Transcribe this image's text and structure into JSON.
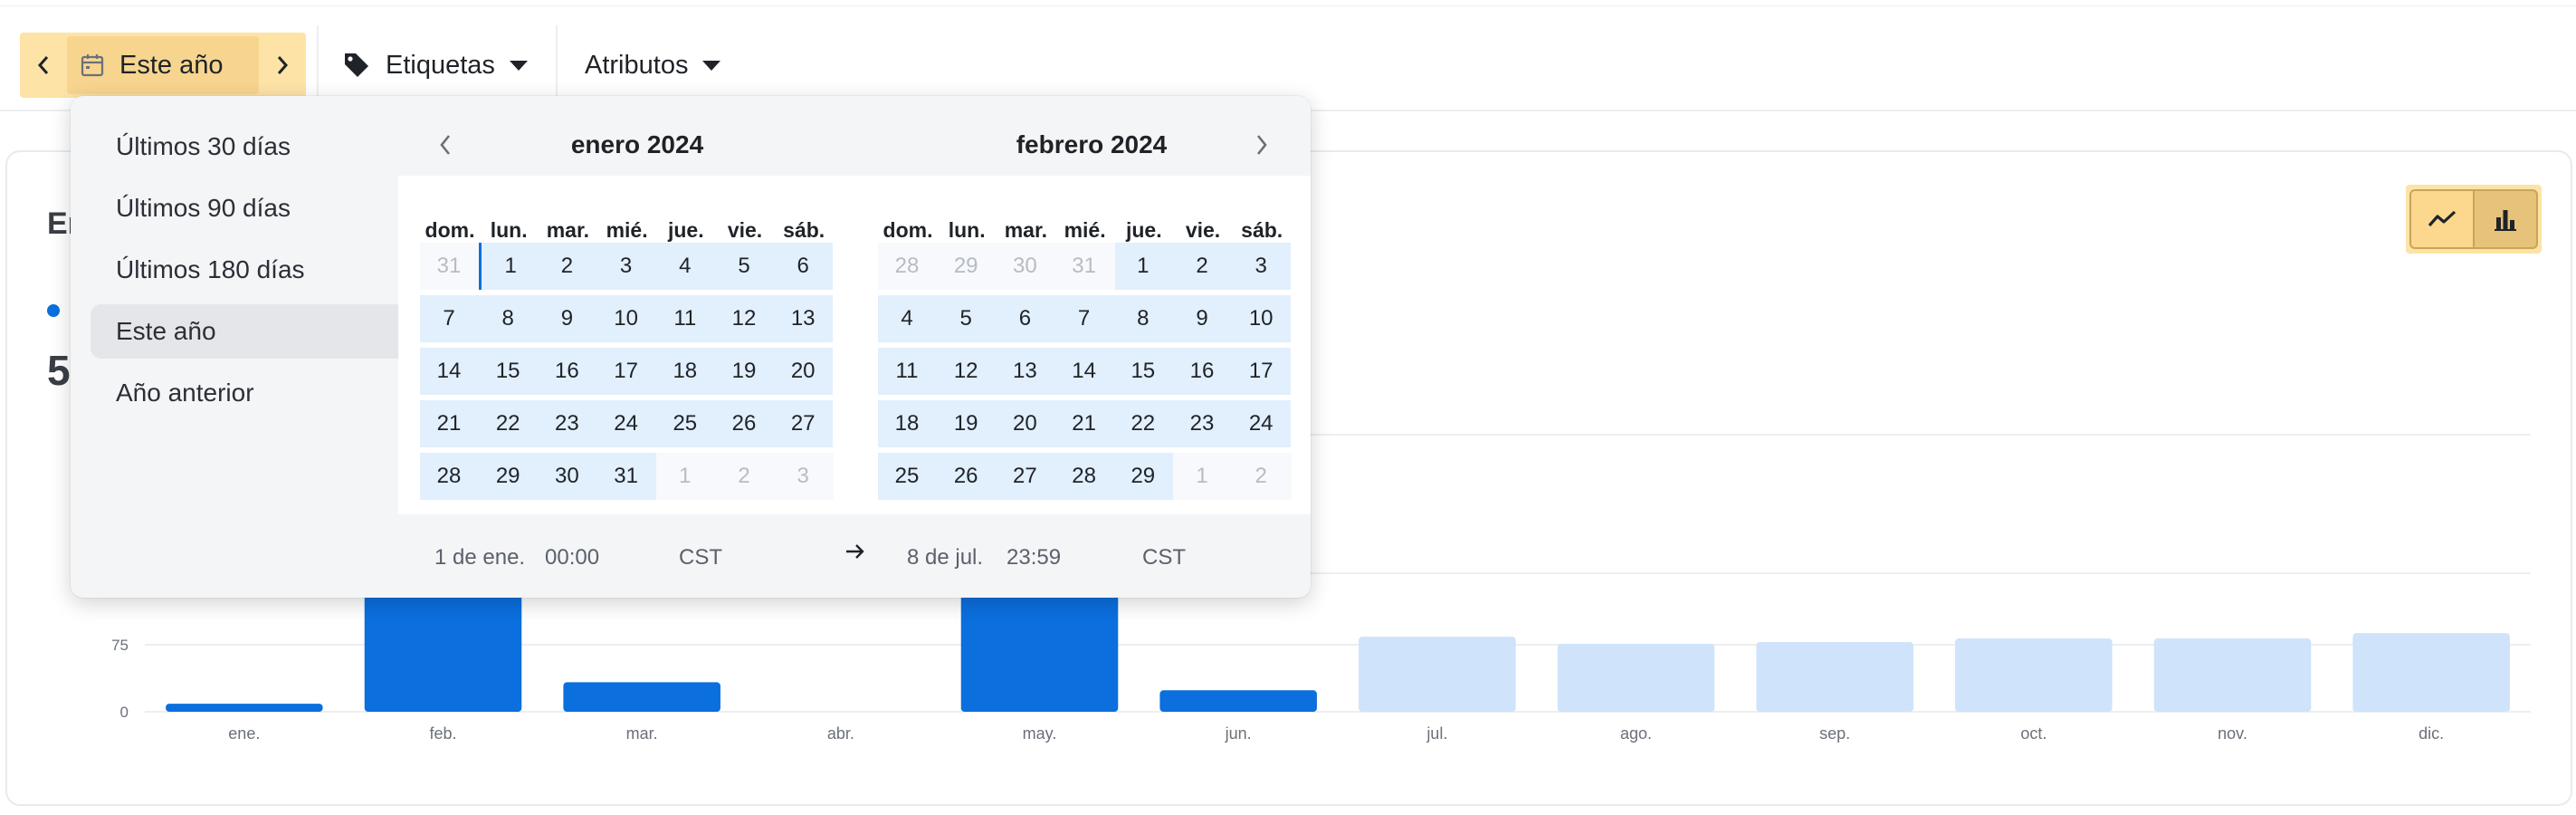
{
  "toolbar": {
    "date_range_label": "Este año",
    "tags_label": "Etiquetas",
    "attributes_label": "Atributos"
  },
  "card": {
    "title_partial": "En",
    "metric_partial": "5"
  },
  "chart_data": {
    "type": "bar",
    "categories": [
      "ene.",
      "feb.",
      "mar.",
      "abr.",
      "may.",
      "jun.",
      "jul.",
      "ago.",
      "sep.",
      "oct.",
      "nov.",
      "dic."
    ],
    "values": [
      9,
      140,
      33,
      0,
      140,
      24,
      84,
      76,
      78,
      82,
      82,
      88
    ],
    "projected_from_index": 6,
    "yticks": [
      0,
      75
    ],
    "ylim": [
      0,
      310
    ],
    "colors": {
      "actual": "#0b6fde",
      "projected": "#cfe3fb"
    }
  },
  "popover": {
    "presets": [
      {
        "label": "Últimos 30 días",
        "active": false
      },
      {
        "label": "Últimos 90 días",
        "active": false
      },
      {
        "label": "Últimos 180 días",
        "active": false
      },
      {
        "label": "Este año",
        "active": true
      },
      {
        "label": "Año anterior",
        "active": false
      }
    ],
    "calendars": [
      {
        "title": "enero 2024",
        "weekdays": [
          "dom.",
          "lun.",
          "mar.",
          "mié.",
          "jue.",
          "vie.",
          "sáb."
        ],
        "weeks": [
          [
            "31",
            "1",
            "2",
            "3",
            "4",
            "5",
            "6"
          ],
          [
            "7",
            "8",
            "9",
            "10",
            "11",
            "12",
            "13"
          ],
          [
            "14",
            "15",
            "16",
            "17",
            "18",
            "19",
            "20"
          ],
          [
            "21",
            "22",
            "23",
            "24",
            "25",
            "26",
            "27"
          ],
          [
            "28",
            "29",
            "30",
            "31",
            "1",
            "2",
            "3"
          ]
        ],
        "outside": [
          [
            0,
            0
          ],
          [
            4,
            4
          ],
          [
            4,
            5
          ],
          [
            4,
            6
          ]
        ]
      },
      {
        "title": "febrero 2024",
        "weekdays": [
          "dom.",
          "lun.",
          "mar.",
          "mié.",
          "jue.",
          "vie.",
          "sáb."
        ],
        "weeks": [
          [
            "28",
            "29",
            "30",
            "31",
            "1",
            "2",
            "3"
          ],
          [
            "4",
            "5",
            "6",
            "7",
            "8",
            "9",
            "10"
          ],
          [
            "11",
            "12",
            "13",
            "14",
            "15",
            "16",
            "17"
          ],
          [
            "18",
            "19",
            "20",
            "21",
            "22",
            "23",
            "24"
          ],
          [
            "25",
            "26",
            "27",
            "28",
            "29",
            "1",
            "2"
          ]
        ],
        "outside": [
          [
            0,
            0
          ],
          [
            0,
            1
          ],
          [
            0,
            2
          ],
          [
            0,
            3
          ],
          [
            4,
            5
          ],
          [
            4,
            6
          ]
        ]
      }
    ],
    "footer": {
      "start_date": "1 de ene.",
      "start_time": "00:00",
      "start_tz": "CST",
      "end_date": "8 de jul.",
      "end_time": "23:59",
      "end_tz": "CST"
    }
  },
  "colors": {
    "accent": "#0b6fde",
    "range_highlight": "#e2effc",
    "toolbar_highlight": "#fde3a6"
  }
}
